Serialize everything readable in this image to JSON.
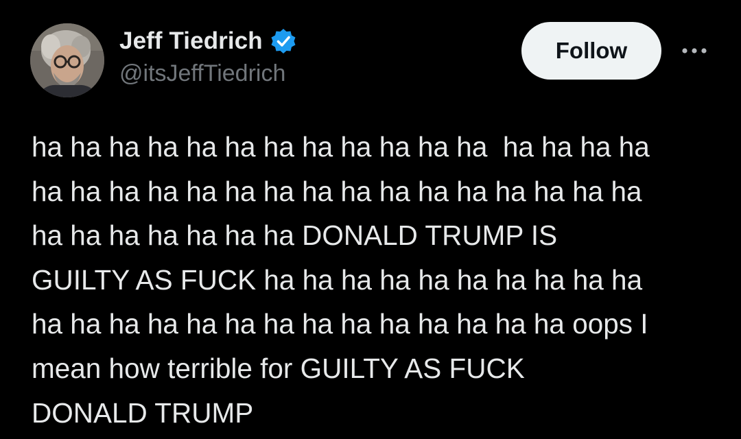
{
  "author": {
    "display_name": "Jeff Tiedrich",
    "handle": "@itsJeffTiedrich",
    "verified_icon": "verified-badge-icon",
    "avatar_icon": "user-avatar"
  },
  "actions": {
    "follow_label": "Follow",
    "more_icon": "more-horizontal-icon"
  },
  "tweet": {
    "lines": [
      "ha ha ha ha ha ha ha ha ha ha ha ha  ha ha ha ha",
      "ha ha ha ha ha ha ha ha ha ha ha ha ha ha ha ha",
      "ha ha ha ha ha ha ha DONALD TRUMP IS",
      "GUILTY AS FUCK ha ha ha ha ha ha ha ha ha ha",
      "ha ha ha ha ha ha ha ha ha ha ha ha ha ha oops I",
      "mean how terrible for GUILTY AS FUCK",
      "DONALD TRUMP"
    ]
  },
  "colors": {
    "background": "#000000",
    "text_primary": "#e7e9ea",
    "text_secondary": "#71767b",
    "verified_blue": "#1d9bf0",
    "follow_button_bg": "#eff3f4",
    "follow_button_text": "#0f1419"
  }
}
